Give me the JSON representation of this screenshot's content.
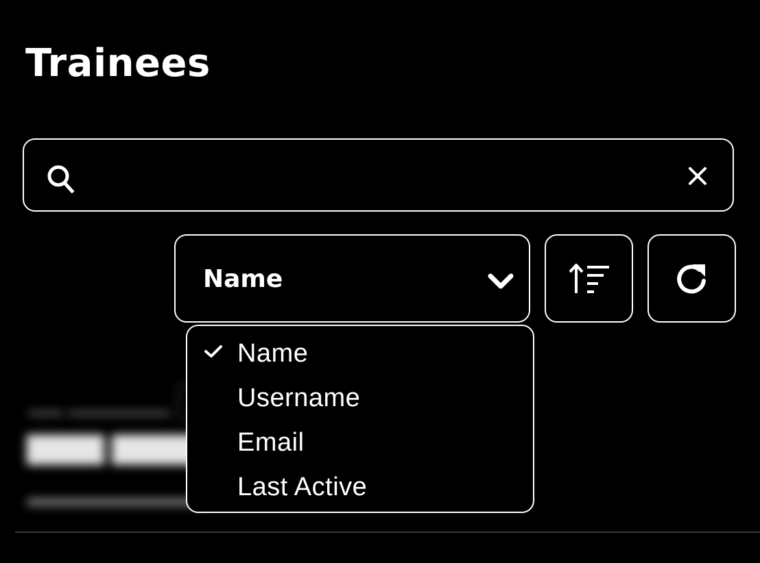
{
  "header": {
    "title": "Trainees"
  },
  "search": {
    "value": "",
    "placeholder": ""
  },
  "sort": {
    "selected": "Name",
    "options": [
      "Name",
      "Username",
      "Email",
      "Last Active"
    ]
  },
  "toolbar": {
    "sort_order_icon": "sort-ascending-icon",
    "refresh_icon": "refresh-icon"
  },
  "colors": {
    "background": "#000000",
    "foreground": "#ffffff",
    "divider": "#3a3a3a"
  }
}
